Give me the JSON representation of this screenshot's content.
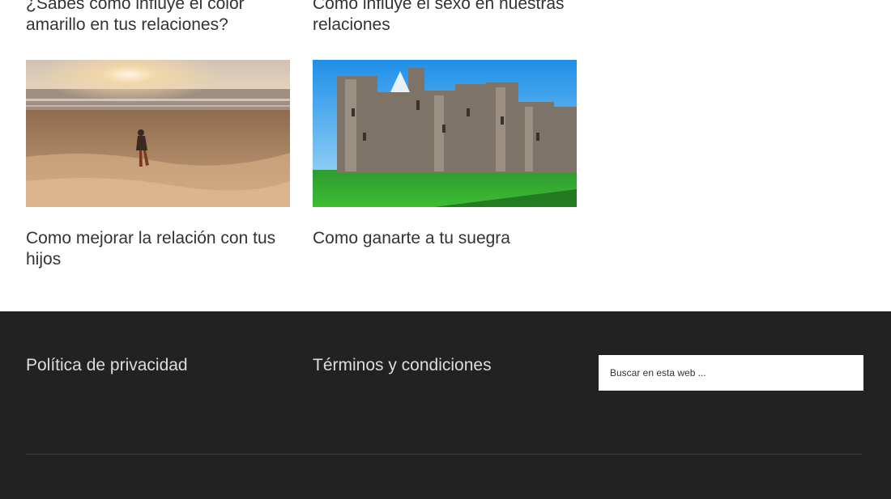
{
  "posts": [
    {
      "title": "¿Sabes cómo influye el color amarillo en tus relaciones?",
      "image": ""
    },
    {
      "title": "Cómo influye el sexo en nuestras relaciones",
      "image": ""
    },
    {
      "title": "Como mejorar la relación con tus hijos",
      "image": "beach-photo"
    },
    {
      "title": "Como ganarte a tu suegra",
      "image": "castle-photo"
    }
  ],
  "footer": {
    "links": [
      {
        "label": "Política de privacidad"
      },
      {
        "label": "Términos y condiciones"
      }
    ],
    "search": {
      "placeholder": "Buscar en esta web ..."
    },
    "background": "#222222"
  }
}
